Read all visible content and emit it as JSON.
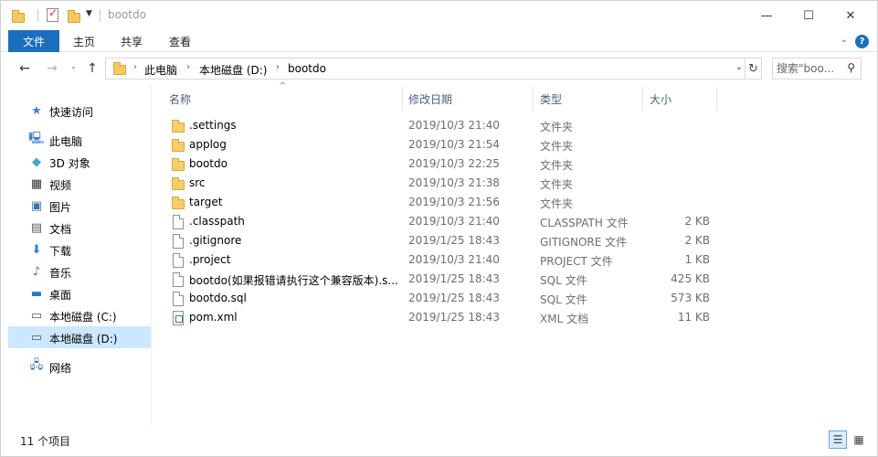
{
  "window": {
    "title": "bootdo",
    "minimize_glyph": "—",
    "maximize_glyph": "☐",
    "close_glyph": "✕"
  },
  "ribbon": {
    "tabs": [
      "文件",
      "主页",
      "共享",
      "查看"
    ],
    "help_glyph": "?",
    "collapse_glyph": "⌄",
    "accent": "#1a6fbf"
  },
  "nav": {
    "back_glyph": "←",
    "forward_glyph": "→",
    "recent_glyph": "⌄",
    "up_glyph": "↑",
    "breadcrumb": [
      "此电脑",
      "本地磁盘 (D:)",
      "bootdo"
    ],
    "crumb_sep": "›",
    "dropdown_glyph": "⌄",
    "refresh_glyph": "↻",
    "search_placeholder": "搜索\"boo...",
    "search_glyph": "⚲"
  },
  "sidebar": {
    "items": [
      {
        "label": "快速访问",
        "icon": "quick-access-star-icon",
        "glyph": "★",
        "color": "#3b7fd4"
      },
      {
        "label": "此电脑",
        "icon": "computer-icon",
        "glyph": "🖳",
        "color": "#3b7fd4"
      },
      {
        "label": "3D 对象",
        "icon": "3d-objects-icon",
        "glyph": "◆",
        "color": "#39a7d8"
      },
      {
        "label": "视频",
        "icon": "video-icon",
        "glyph": "▦",
        "color": "#333333"
      },
      {
        "label": "图片",
        "icon": "pictures-icon",
        "glyph": "▣",
        "color": "#3a6ea5"
      },
      {
        "label": "文档",
        "icon": "documents-icon",
        "glyph": "▤",
        "color": "#5a5a5a"
      },
      {
        "label": "下载",
        "icon": "downloads-icon",
        "glyph": "⬇",
        "color": "#2f7fd8"
      },
      {
        "label": "音乐",
        "icon": "music-icon",
        "glyph": "♪",
        "color": "#2a73c9"
      },
      {
        "label": "桌面",
        "icon": "desktop-icon",
        "glyph": "▬",
        "color": "#1f78c8"
      },
      {
        "label": "本地磁盘 (C:)",
        "icon": "drive-c-icon",
        "glyph": "▭",
        "color": "#555555"
      },
      {
        "label": "本地磁盘 (D:)",
        "icon": "drive-d-icon",
        "glyph": "▭",
        "color": "#555555",
        "selected": true
      },
      {
        "label": "网络",
        "icon": "network-icon",
        "glyph": "🖧",
        "color": "#2f6fb5"
      }
    ]
  },
  "columns": {
    "name": "名称",
    "date": "修改日期",
    "type": "类型",
    "size": "大小",
    "sort_glyph": "^"
  },
  "files": [
    {
      "name": ".settings",
      "date": "2019/10/3 21:40",
      "type": "文件夹",
      "size": "",
      "kind": "folder"
    },
    {
      "name": "applog",
      "date": "2019/10/3 21:54",
      "type": "文件夹",
      "size": "",
      "kind": "folder"
    },
    {
      "name": "bootdo",
      "date": "2019/10/3 22:25",
      "type": "文件夹",
      "size": "",
      "kind": "folder"
    },
    {
      "name": "src",
      "date": "2019/10/3 21:38",
      "type": "文件夹",
      "size": "",
      "kind": "folder"
    },
    {
      "name": "target",
      "date": "2019/10/3 21:56",
      "type": "文件夹",
      "size": "",
      "kind": "folder"
    },
    {
      "name": ".classpath",
      "date": "2019/10/3 21:40",
      "type": "CLASSPATH 文件",
      "size": "2 KB",
      "kind": "file"
    },
    {
      "name": ".gitignore",
      "date": "2019/1/25 18:43",
      "type": "GITIGNORE 文件",
      "size": "2 KB",
      "kind": "file"
    },
    {
      "name": ".project",
      "date": "2019/10/3 21:40",
      "type": "PROJECT 文件",
      "size": "1 KB",
      "kind": "file"
    },
    {
      "name": "bootdo(如果报错请执行这个兼容版本).s...",
      "date": "2019/1/25 18:43",
      "type": "SQL 文件",
      "size": "425 KB",
      "kind": "file"
    },
    {
      "name": "bootdo.sql",
      "date": "2019/1/25 18:43",
      "type": "SQL 文件",
      "size": "573 KB",
      "kind": "file"
    },
    {
      "name": "pom.xml",
      "date": "2019/1/25 18:43",
      "type": "XML 文档",
      "size": "11 KB",
      "kind": "xml"
    }
  ],
  "status": {
    "item_count": "11 个项目",
    "details_view_glyph": "☰",
    "icons_view_glyph": "▦"
  }
}
